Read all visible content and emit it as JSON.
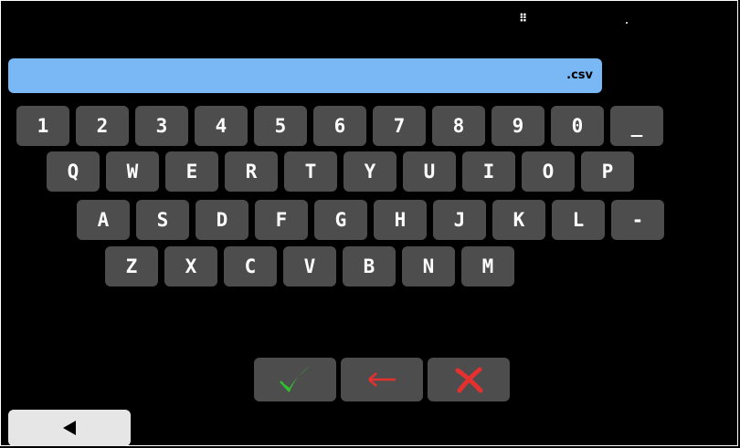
{
  "status": {
    "grip_glyph": "⠿"
  },
  "input": {
    "value": ".csv"
  },
  "keyboard": {
    "row1": [
      "1",
      "2",
      "3",
      "4",
      "5",
      "6",
      "7",
      "8",
      "9",
      "0",
      "_"
    ],
    "row2": [
      "Q",
      "W",
      "E",
      "R",
      "T",
      "Y",
      "U",
      "I",
      "O",
      "P"
    ],
    "row3": [
      "A",
      "S",
      "D",
      "F",
      "G",
      "H",
      "J",
      "K",
      "L",
      "-"
    ],
    "row4": [
      "Z",
      "X",
      "C",
      "V",
      "B",
      "N",
      "M"
    ]
  },
  "actions": {
    "confirm_icon": "check-icon",
    "backspace_icon": "arrow-left-icon",
    "cancel_icon": "close-icon",
    "confirm_color": "#2fbf2f",
    "backspace_color": "#e53030",
    "cancel_color": "#e53030"
  },
  "nav": {
    "back_icon": "triangle-left-icon"
  },
  "colors": {
    "background": "#000000",
    "input_bg": "#79b8f4",
    "key_bg": "#4d4d4d",
    "key_text": "#ffffff",
    "back_bg": "#e6e6e6"
  }
}
